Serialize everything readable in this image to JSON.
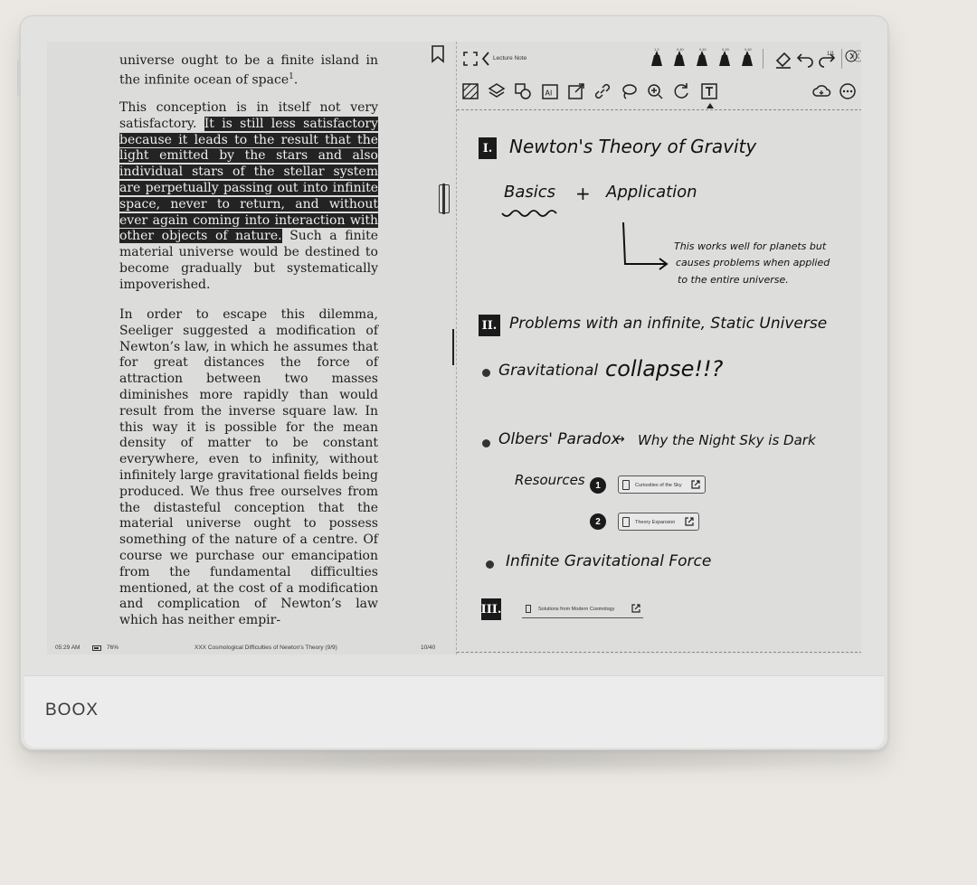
{
  "device": {
    "brand": "BOOX"
  },
  "reader": {
    "paragraphs": [
      {
        "segments": [
          {
            "text": "universe ought to be a finite island in the infinite ocean of space",
            "hl": false
          },
          {
            "text": "1",
            "sup": true
          },
          {
            "text": ".",
            "hl": false
          }
        ]
      },
      {
        "segments": [
          {
            "text": "This conception is in itself not very satisfactory. ",
            "hl": false
          },
          {
            "text": "It is still less satisfactory because it leads to the result that the light emitted by the stars and also individual stars of the stellar system are perpetually passing out into infinite space, never to return, and without ever again coming into interaction with other objects of nature.",
            "hl": true
          },
          {
            "text": " Such a finite material universe would be destined to become gradually but systematically impoverished.",
            "hl": false
          }
        ]
      },
      {
        "segments": [
          {
            "text": "In order to escape this dilemma, Seeliger suggested a modification of Newton’s law, in which he assumes that for great distances the force of attraction between two masses diminishes more rapidly than would result from the inverse square law. In this way it is possible for the mean density of matter to be constant everywhere, even to infinity, without infinitely large gravitational fields being produced. We thus free ourselves from the distasteful conception that the material universe ought to possess something of the nature of a centre. Of course we purchase our emancipation from the fundamental difficulties mentioned, at the cost of a modification and complication of Newton’s law which has neither empir-",
            "hl": false
          }
        ]
      }
    ],
    "status": {
      "time": "05:29 AM",
      "battery": "76%",
      "chapter": "XXX Cosmological Difficulties of Newton's Theory (9/9)",
      "page": "10/40"
    }
  },
  "notes": {
    "toolbar": {
      "title": "Lecture Note",
      "page_indicator": "1/1",
      "pen_sizes": [
        "1.2",
        "0.40",
        "0.40",
        "0.15",
        "0.40"
      ]
    },
    "content": {
      "s1_num": "I.",
      "s1_title": "Newton's Theory of Gravity",
      "basics": "Basics",
      "plus": "+",
      "application": "Application",
      "arrow_note_1": "This works well for planets but",
      "arrow_note_2": "causes problems when applied",
      "arrow_note_3": "to the entire universe.",
      "s2_num": "II.",
      "s2_title": "Problems with an infinite, Static Universe",
      "b1_a": "Gravitational",
      "b1_b": "collapse!!?",
      "b2_a": "Olbers' Paradox",
      "b2_arrow": "→",
      "b2_b": "Why the Night Sky is Dark",
      "resources": "Resources",
      "r1_num": "1",
      "r1_title": "Curiosities of the Sky",
      "r2_num": "2",
      "r2_title": "Theory Expansion",
      "b3": "Infinite Gravitational Force",
      "s3_num": "III.",
      "s3_link": "Solutions from Modern Cosmology"
    }
  }
}
